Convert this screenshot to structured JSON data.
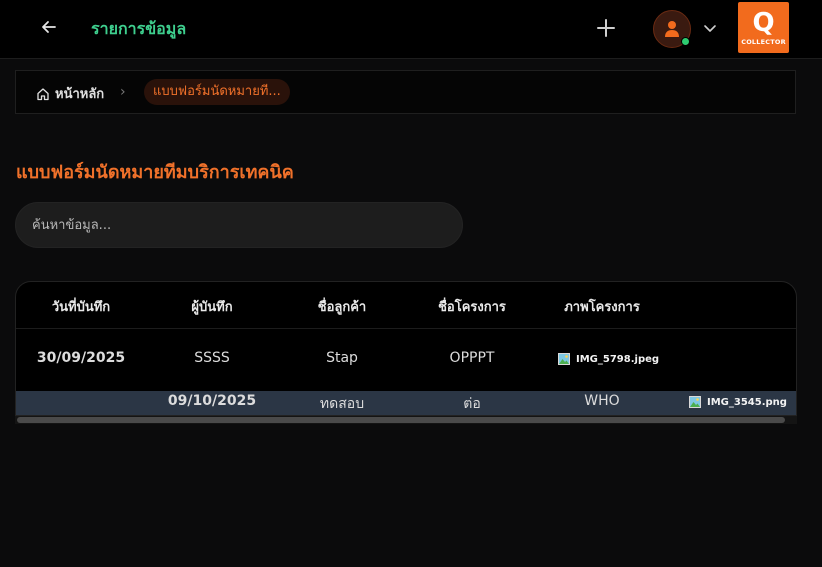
{
  "header": {
    "title": "รายการข้อมูล",
    "logo_letter": "Q",
    "logo_text": "COLLECTOR",
    "online_color": "#2ecc71"
  },
  "breadcrumb": {
    "home": "หน้าหลัก",
    "current": "แบบฟอร์มนัดหมายที..."
  },
  "page": {
    "title": "แบบฟอร์มนัดหมายทีมบริการเทคนิค",
    "search_placeholder": "ค้นหาข้อมูล..."
  },
  "table": {
    "columns": [
      "วันที่บันทึก",
      "ผู้บันทึก",
      "ชื่อลูกค้า",
      "ชื่อโครงการ",
      "ภาพโครงการ"
    ],
    "rows": [
      {
        "date": "30/09/2025",
        "recorder": "SSSS",
        "customer": "Stap",
        "project": "OPPPT",
        "image": "IMG_5798.jpeg"
      },
      {
        "date": "09/10/2025",
        "recorder": "ทดสอบ",
        "customer": "ต่อ",
        "project": "WHO",
        "image": "IMG_3545.png"
      }
    ]
  },
  "colors": {
    "accent": "#f0712a",
    "title_green": "#3ecf8e",
    "row_highlight": "#2b3645"
  }
}
